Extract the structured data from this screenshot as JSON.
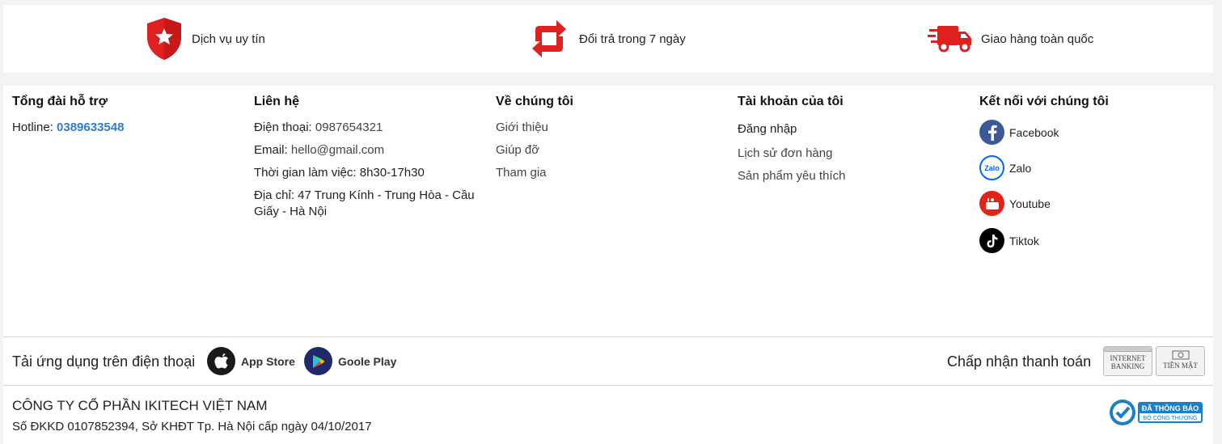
{
  "features": [
    {
      "icon": "shield-star-icon",
      "label": "Dịch vụ uy tín"
    },
    {
      "icon": "return-icon",
      "label": "Đổi trả trong 7 ngày"
    },
    {
      "icon": "delivery-truck-icon",
      "label": "Giao hàng toàn quốc"
    }
  ],
  "support": {
    "title": "Tổng đài hỗ trợ",
    "hotline_label": "Hotline:",
    "hotline_number": "0389633548"
  },
  "contact": {
    "title": "Liên hệ",
    "phone_label": "Điện thoại:",
    "phone_value": "0987654321",
    "email_label": "Email:",
    "email_value": "hello@gmail.com",
    "hours_label": "Thời gian làm việc:",
    "hours_value": "8h30-17h30",
    "address_line1": "Địa chỉ: 47 Trung Kính - Trung Hòa - Cầu",
    "address_line2": "Giấy - Hà Nội"
  },
  "about": {
    "title": "Về chúng tôi",
    "links": [
      "Giới thiệu",
      "Giúp đỡ",
      "Tham gia"
    ]
  },
  "account": {
    "title": "Tài khoản của tôi",
    "links": [
      "Đăng nhập",
      "Lịch sử đơn hàng",
      "Sản phẩm yêu thích"
    ]
  },
  "social": {
    "title": "Kết nối với chúng tôi",
    "items": [
      {
        "icon": "facebook-icon",
        "label": "Facebook",
        "color": "#3b5998"
      },
      {
        "icon": "zalo-icon",
        "label": "Zalo",
        "color": "#0068ff"
      },
      {
        "icon": "youtube-icon",
        "label": "Youtube",
        "color": "#e62117"
      },
      {
        "icon": "tiktok-icon",
        "label": "Tiktok",
        "color": "#000000"
      }
    ]
  },
  "apps": {
    "label": "Tải ứng dụng trên điện thoại",
    "app_store": "App Store",
    "google_play": "Goole Play"
  },
  "payment": {
    "label": "Chấp nhận thanh toán",
    "internet_banking_line1": "INTERNET",
    "internet_banking_line2": "BANKING",
    "cash": "TIỀN MẶT"
  },
  "company": {
    "name": "CÔNG TY CỔ PHẦN IKITECH VIỆT NAM",
    "registration": "Số ĐKKD 0107852394, Sở KHĐT Tp. Hà Nội cấp ngày 04/10/2017",
    "badge_line1": "ĐÃ THÔNG BÁO",
    "badge_line2": "BỘ CÔNG THƯƠNG"
  },
  "colors": {
    "accent_red": "#e02020",
    "link_blue": "#2f7bd6"
  }
}
